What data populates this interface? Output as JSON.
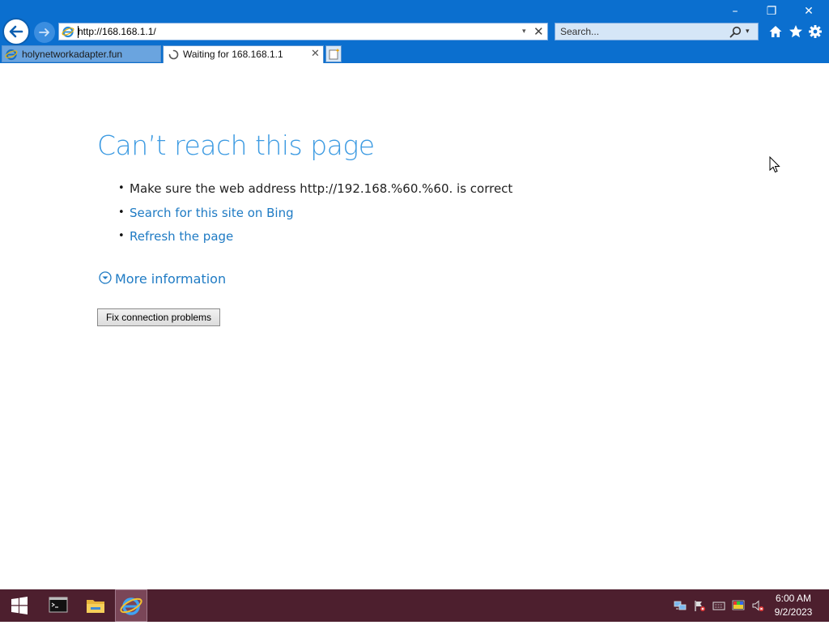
{
  "window": {
    "minimize_glyph": "–",
    "restore_glyph": "❐",
    "close_glyph": "✕"
  },
  "address_bar": {
    "url": "http://168.168.1.1/",
    "stop_glyph": "✕",
    "dropdown_glyph": "▾"
  },
  "search": {
    "placeholder": "Search...",
    "dropdown_glyph": "▾"
  },
  "tabs": [
    {
      "label": "holynetworkadapter.fun",
      "active": false
    },
    {
      "label": "Waiting for 168.168.1.1",
      "active": true,
      "close_glyph": "✕"
    }
  ],
  "error_page": {
    "title": "Can’t reach this page",
    "bullet_glyph": "•",
    "tips": [
      "Make sure the web address http://192.168.%60.%60. is correct",
      "Search for this site on Bing",
      "Refresh the page"
    ],
    "more_info": "More information",
    "fix_button": "Fix connection problems"
  },
  "taskbar": {
    "time": "6:00 AM",
    "date": "9/2/2023"
  },
  "colors": {
    "chrome_blue": "#0b6fcf",
    "title_blue": "#3d9be2",
    "link_blue": "#1f7bc4",
    "taskbar": "#4d1f2e"
  }
}
